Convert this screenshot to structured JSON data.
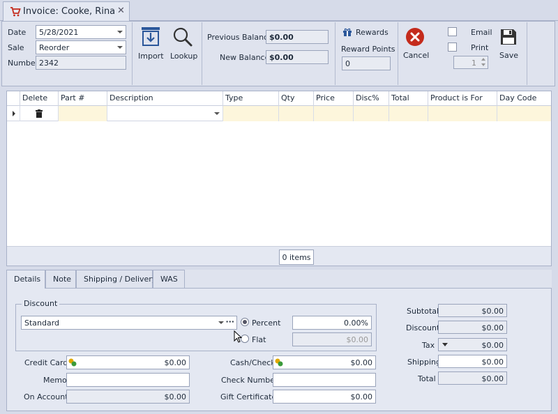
{
  "tab": {
    "title": "Invoice: Cooke, Rina",
    "close": "✕"
  },
  "form": {
    "date_label": "Date",
    "date_value": "5/28/2021",
    "sale_label": "Sale",
    "sale_value": "Reorder",
    "number_label": "Number",
    "number_value": "2342"
  },
  "toolbar": {
    "import_label": "Import",
    "lookup_label": "Lookup",
    "previous_balance_label": "Previous Balance",
    "previous_balance_value": "$0.00",
    "new_balance_label": "New Balance",
    "new_balance_value": "$0.00",
    "rewards_label": "Rewards",
    "reward_points_label": "Reward Points",
    "reward_points_value": "0",
    "cancel_label": "Cancel",
    "email_label": "Email",
    "print_label": "Print",
    "copies_value": "1",
    "save_label": "Save"
  },
  "grid": {
    "columns": [
      "Delete",
      "Part #",
      "Description",
      "Type",
      "Qty",
      "Price",
      "Disc%",
      "Total",
      "Product is For",
      "Day Code"
    ],
    "items_count": "0 items"
  },
  "bottom_tabs": [
    "Details",
    "Note",
    "Shipping / Delivery",
    "WAS"
  ],
  "details": {
    "discount_group_title": "Discount",
    "discount_type_value": "Standard",
    "discount_more": "···",
    "percent_label": "Percent",
    "percent_value": "0.00%",
    "flat_label": "Flat",
    "flat_value": "$0.00",
    "credit_card_label": "Credit Card",
    "credit_card_value": "$0.00",
    "memo_label": "Memo",
    "memo_value": "",
    "on_account_label": "On Account",
    "on_account_value": "$0.00",
    "cash_check_label": "Cash/Check",
    "cash_check_value": "$0.00",
    "check_number_label": "Check Number",
    "check_number_value": "",
    "gift_certificate_label": "Gift Certificate",
    "gift_certificate_value": "$0.00"
  },
  "totals": {
    "subtotal_label": "Subtotal",
    "subtotal_value": "$0.00",
    "discount_label": "Discount",
    "discount_value": "$0.00",
    "tax_label": "Tax",
    "tax_value": "$0.00",
    "shipping_label": "Shipping",
    "shipping_value": "$0.00",
    "total_label": "Total",
    "total_value": "$0.00"
  },
  "colors": {
    "accent": "#2b579a",
    "cancel_red": "#c42b1c",
    "grid_yellow": "#fdf6dc"
  }
}
